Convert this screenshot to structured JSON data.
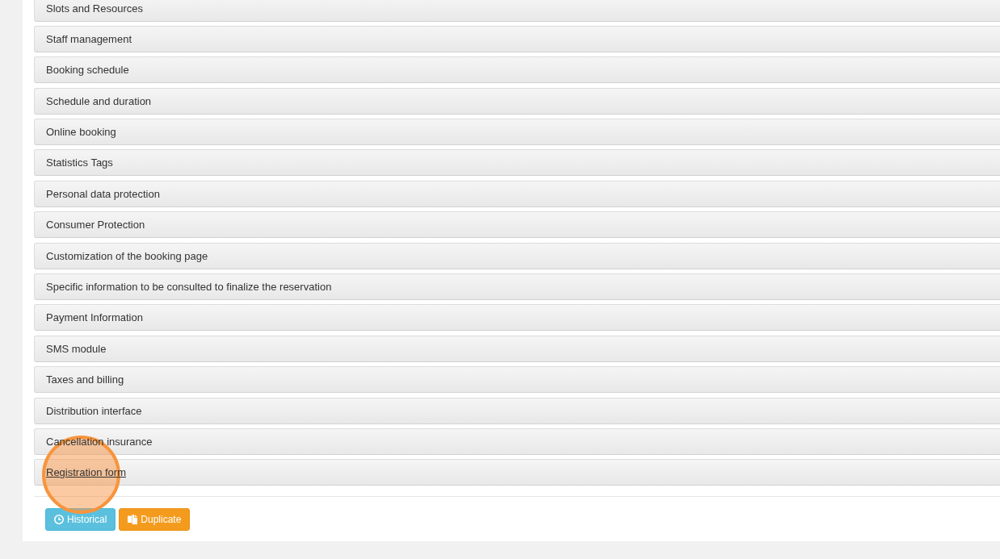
{
  "sections": [
    {
      "title": "Slots and Resources",
      "hovered": false
    },
    {
      "title": "Staff management",
      "hovered": false
    },
    {
      "title": "Booking schedule",
      "hovered": false
    },
    {
      "title": "Schedule and duration",
      "hovered": false
    },
    {
      "title": "Online booking",
      "hovered": false
    },
    {
      "title": "Statistics Tags",
      "hovered": false
    },
    {
      "title": "Personal data protection",
      "hovered": false
    },
    {
      "title": "Consumer Protection",
      "hovered": false
    },
    {
      "title": "Customization of the booking page",
      "hovered": false
    },
    {
      "title": "Specific information to be consulted to finalize the reservation",
      "hovered": false
    },
    {
      "title": "Payment Information",
      "hovered": false
    },
    {
      "title": "SMS module",
      "hovered": false
    },
    {
      "title": "Taxes and billing",
      "hovered": false
    },
    {
      "title": "Distribution interface",
      "hovered": false
    },
    {
      "title": "Cancellation insurance",
      "hovered": false
    },
    {
      "title": "Registration form",
      "hovered": true
    }
  ],
  "actions": [
    {
      "label": "Historical",
      "kind": "history"
    },
    {
      "label": "Duplicate",
      "kind": "duplicate"
    }
  ]
}
